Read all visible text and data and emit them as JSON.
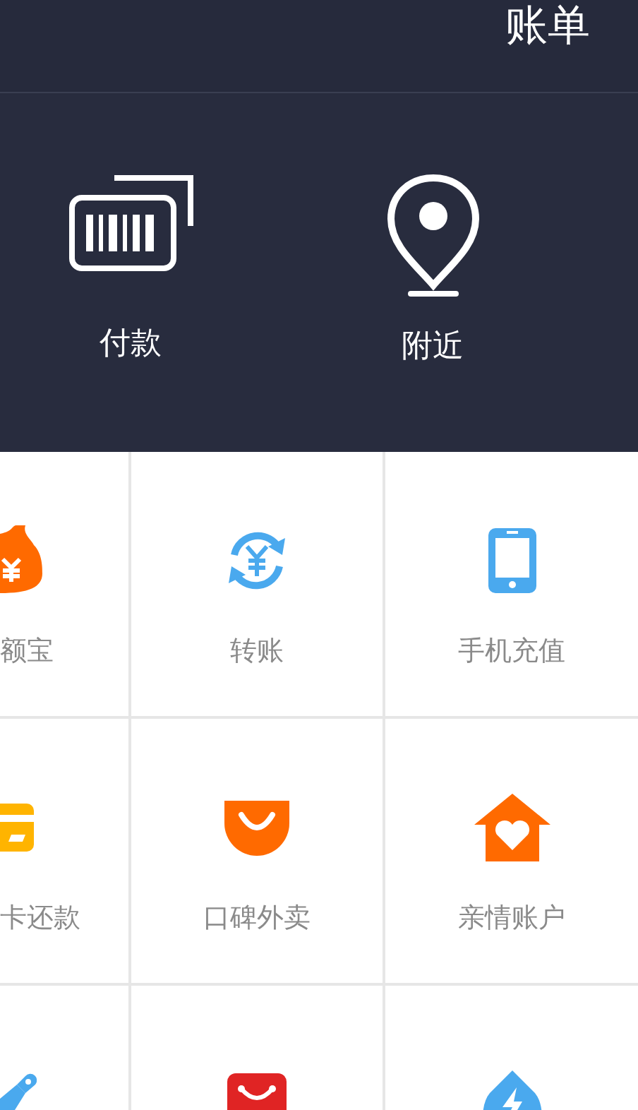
{
  "header": {
    "title": "账单"
  },
  "actions": [
    {
      "label": "付款"
    },
    {
      "label": "附近"
    }
  ],
  "grid": [
    {
      "kind": "labeled",
      "label": "额宝"
    },
    {
      "kind": "labeled",
      "label": "转账"
    },
    {
      "kind": "labeled",
      "label": "手机充值"
    },
    {
      "kind": "labeled",
      "label": "卡还款"
    },
    {
      "kind": "labeled",
      "label": "口碑外卖"
    },
    {
      "kind": "labeled",
      "label": "亲情账户"
    },
    {
      "kind": "icon"
    },
    {
      "kind": "icon"
    },
    {
      "kind": "icon"
    }
  ]
}
